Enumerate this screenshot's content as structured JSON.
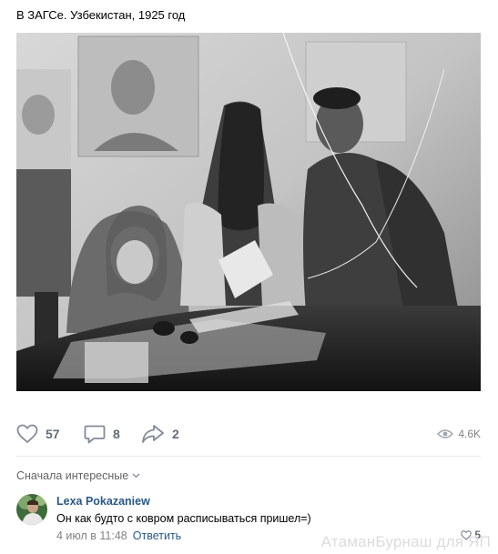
{
  "post": {
    "text": "В ЗАГСе. Узбекистан, 1925 год"
  },
  "photo": {
    "icon": "archival-photograph"
  },
  "actions": {
    "like_count": "57",
    "comment_count": "8",
    "share_count": "2",
    "views_count": "4.6K"
  },
  "comments_section": {
    "sort_label": "Сначала интересные"
  },
  "comment": {
    "author": "Lexa Pokazaniew",
    "text": "Он как будто с ковром расписываться пришел=)",
    "date": "4 июл в 11:48",
    "reply_label": "Ответить",
    "likes": "5"
  },
  "watermark": "АтаманБурнаш для ЯП",
  "colors": {
    "link": "#2a5885",
    "icon": "#828a99",
    "count": "#626d7a",
    "meta": "#828282"
  }
}
